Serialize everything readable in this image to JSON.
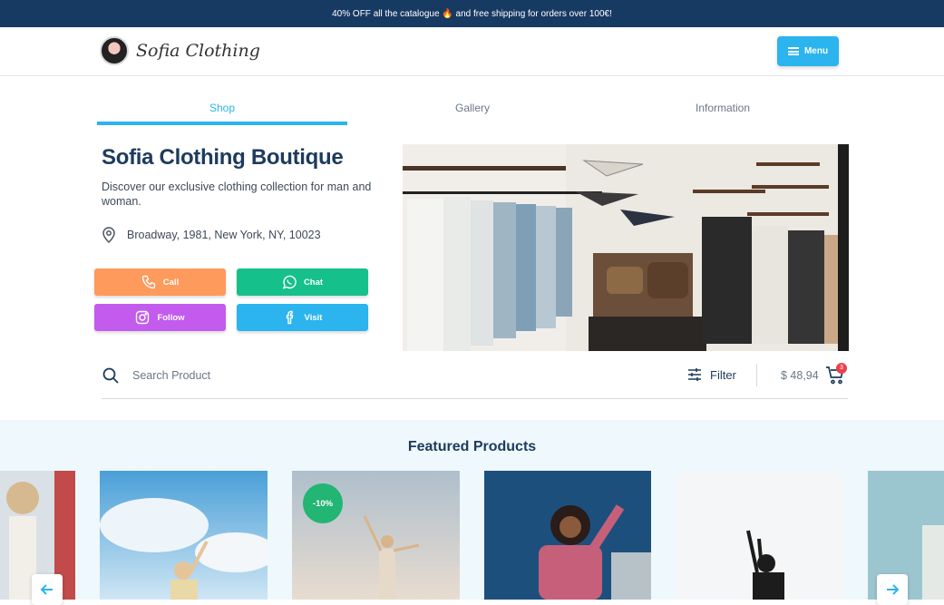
{
  "promo": {
    "text": "40% OFF all the catalogue 🔥 and free shipping for orders over 100€!"
  },
  "header": {
    "logo_text": "Sofia Clothing",
    "menu_label": "Menu"
  },
  "tabs": [
    {
      "label": "Shop"
    },
    {
      "label": "Gallery"
    },
    {
      "label": "Information"
    }
  ],
  "shop": {
    "title": "Sofia Clothing Boutique",
    "description": "Discover our exclusive clothing collection for man and woman.",
    "address": "Broadway, 1981, New York, NY, 10023"
  },
  "contact_buttons": [
    {
      "label": "Call",
      "color": "#fd9a5c",
      "icon": "phone-icon"
    },
    {
      "label": "Chat",
      "color": "#15c08b",
      "icon": "whatsapp-icon"
    },
    {
      "label": "Follow",
      "color": "#c35bef",
      "icon": "instagram-icon"
    },
    {
      "label": "Visit",
      "color": "#2bb4ee",
      "icon": "facebook-icon"
    }
  ],
  "search": {
    "placeholder": "Search Product"
  },
  "filter": {
    "label": "Filter"
  },
  "cart": {
    "total": "$ 48,94",
    "count": "3"
  },
  "featured": {
    "title": "Featured Products",
    "products": [
      {
        "badge": ""
      },
      {
        "badge": ""
      },
      {
        "badge": "-10%"
      },
      {
        "badge": ""
      },
      {
        "badge": ""
      },
      {
        "badge": ""
      }
    ]
  },
  "colors": {
    "accent": "#2bb4ee",
    "navy": "#173a63",
    "discount": "#22b573"
  }
}
